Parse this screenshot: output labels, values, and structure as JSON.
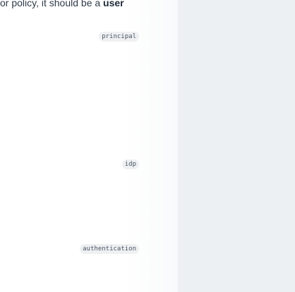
{
  "content": {
    "intro_prefix": "or policy, it should be a ",
    "intro_bold": "user"
  },
  "tags": {
    "principal": "principal",
    "idp": "idp",
    "authentication": "authentication"
  }
}
